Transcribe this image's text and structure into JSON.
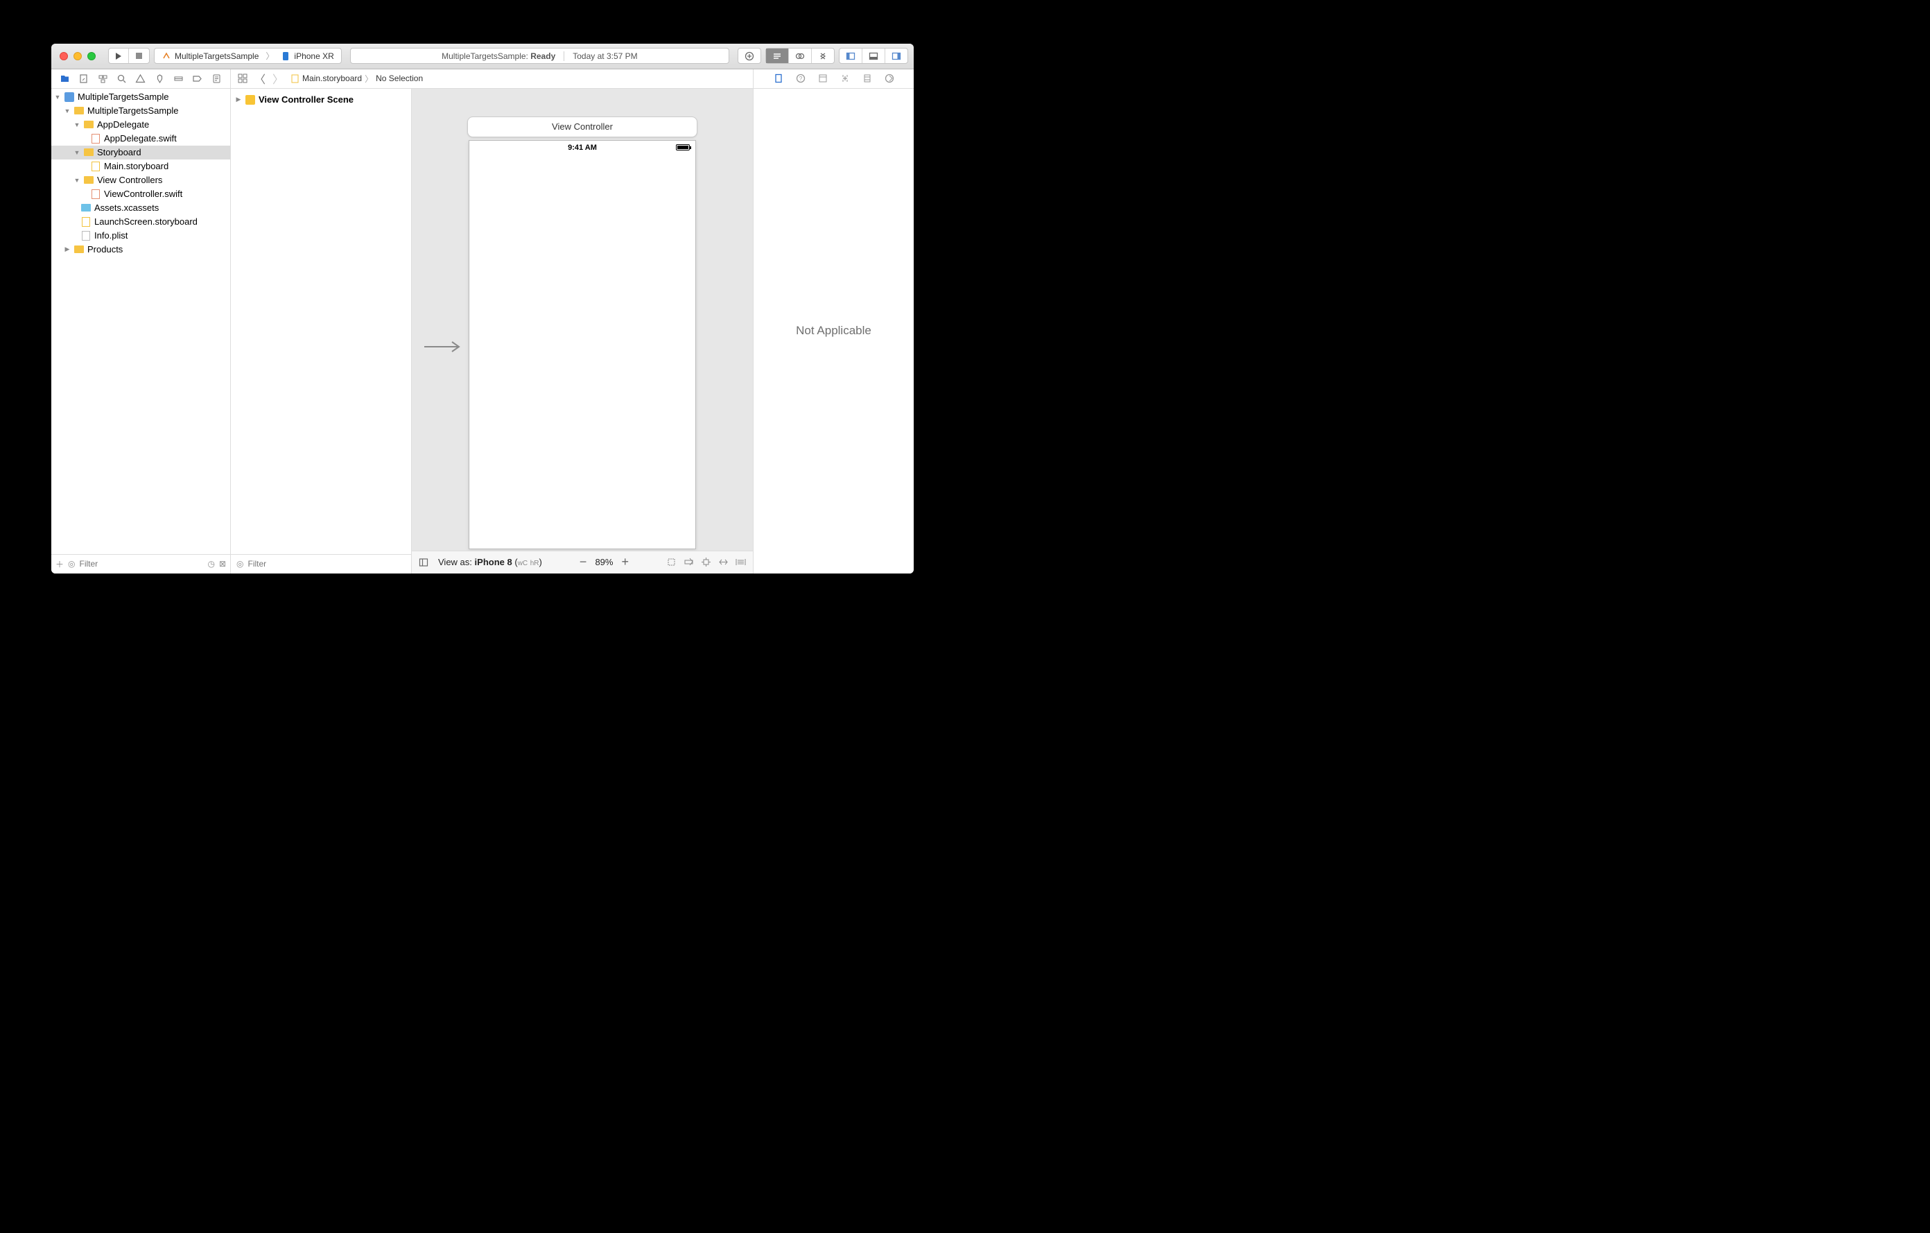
{
  "toolbar": {
    "scheme_name": "MultipleTargetsSample",
    "device_name": "iPhone XR",
    "status_app": "MultipleTargetsSample:",
    "status_state": "Ready",
    "status_time": "Today at 3:57 PM"
  },
  "jumpbar": {
    "file": "Main.storyboard",
    "selection": "No Selection"
  },
  "navigator": {
    "filter_placeholder": "Filter",
    "tree": {
      "root": "MultipleTargetsSample",
      "group_main": "MultipleTargetsSample",
      "group_appdelegate": "AppDelegate",
      "file_appdelegate": "AppDelegate.swift",
      "group_storyboard": "Storyboard",
      "file_mainsb": "Main.storyboard",
      "group_vc": "View Controllers",
      "file_vc": "ViewController.swift",
      "file_assets": "Assets.xcassets",
      "file_launch": "LaunchScreen.storyboard",
      "file_info": "Info.plist",
      "group_products": "Products"
    }
  },
  "outline": {
    "scene_name": "View Controller Scene",
    "filter_placeholder": "Filter"
  },
  "canvas": {
    "vc_title": "View Controller",
    "phone_time": "9:41 AM",
    "view_as_label": "View as:",
    "view_as_device": "iPhone 8",
    "wc": "wC",
    "hr": "hR",
    "zoom": "89%"
  },
  "inspector": {
    "placeholder": "Not Applicable"
  }
}
